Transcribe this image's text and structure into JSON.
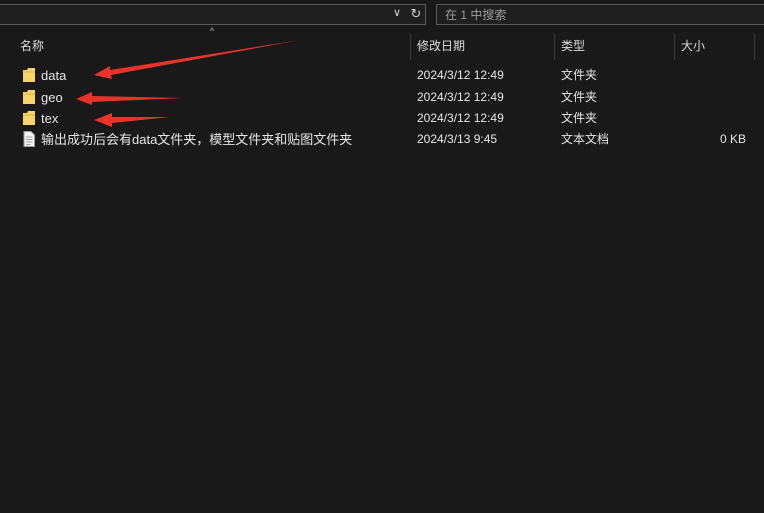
{
  "search": {
    "placeholder": "在 1 中搜索",
    "dropdown_glyph": "∨",
    "refresh_glyph": "↻"
  },
  "columns": {
    "name": "名称",
    "date": "修改日期",
    "type": "类型",
    "size": "大小",
    "sort_glyph": "^"
  },
  "files": [
    {
      "name": "data",
      "date": "2024/3/12 12:49",
      "type": "文件夹",
      "size": "",
      "icon": "folder-icon"
    },
    {
      "name": "geo",
      "date": "2024/3/12 12:49",
      "type": "文件夹",
      "size": "",
      "icon": "folder-icon"
    },
    {
      "name": "tex",
      "date": "2024/3/12 12:49",
      "type": "文件夹",
      "size": "",
      "icon": "folder-icon"
    },
    {
      "name": "输出成功后会有data文件夹，模型文件夹和贴图文件夹",
      "date": "2024/3/13 9:45",
      "type": "文本文档",
      "size": "0 KB",
      "icon": "text-file-icon"
    }
  ],
  "colors": {
    "background": "#191919",
    "folder": "#f7d36b",
    "arrow": "#e8332b"
  }
}
